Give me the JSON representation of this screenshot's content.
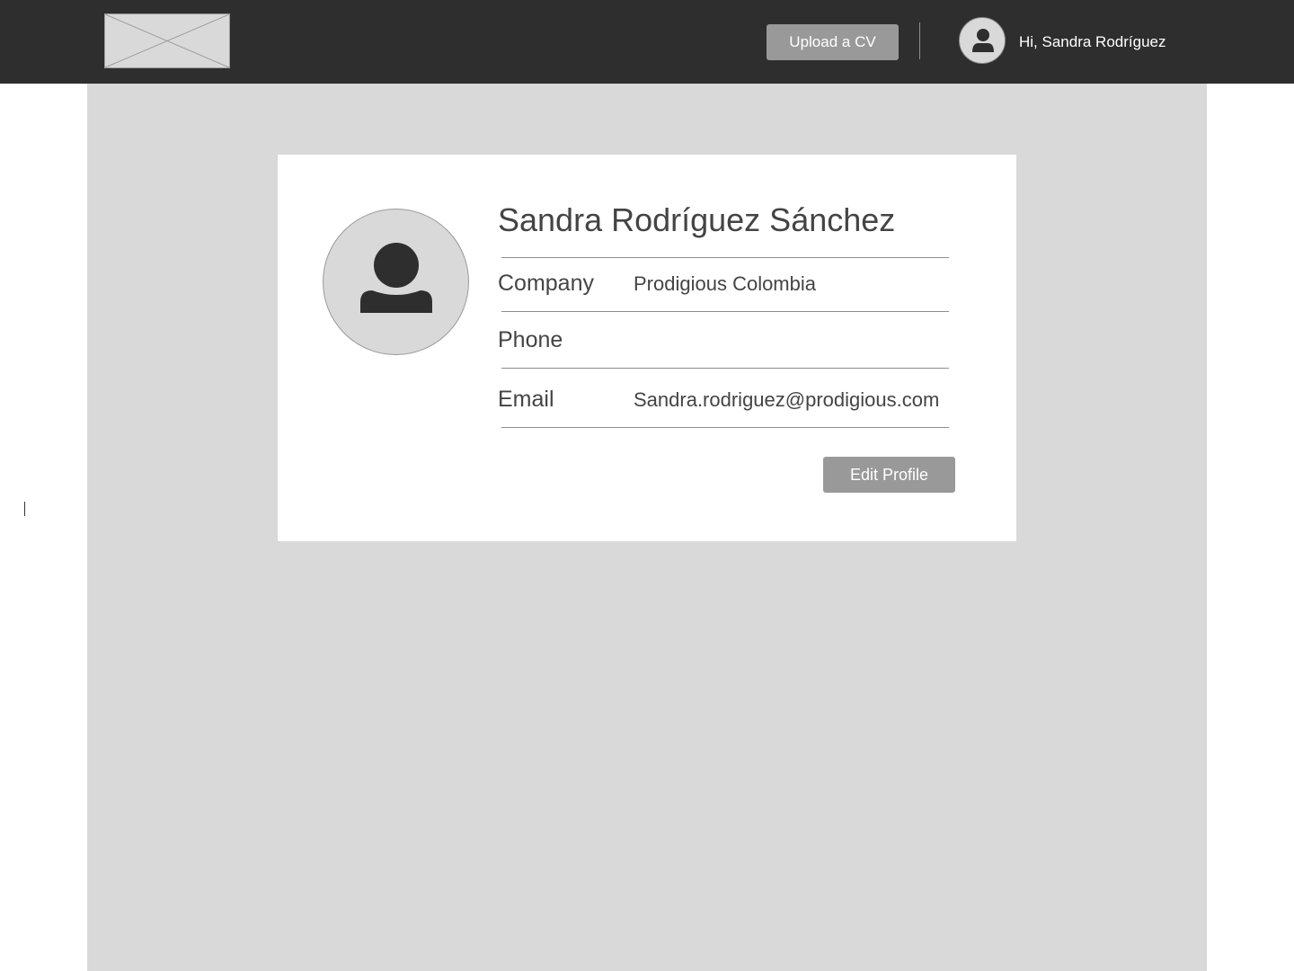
{
  "header": {
    "logo_icon": "image-placeholder-icon",
    "upload_label": "Upload a CV",
    "avatar_icon": "user-icon",
    "greeting": "Hi, Sandra Rodríguez"
  },
  "profile": {
    "avatar_icon": "user-icon",
    "full_name": "Sandra Rodríguez Sánchez",
    "fields": [
      {
        "label": "Company",
        "value": "Prodigious Colombia"
      },
      {
        "label": "Phone",
        "value": ""
      },
      {
        "label": "Email",
        "value": "Sandra.rodriguez@prodigious.com"
      }
    ],
    "edit_label": "Edit Profile"
  },
  "colors": {
    "header_bg": "#2e2e2e",
    "canvas_bg": "#d9d9d9",
    "card_bg": "#ffffff",
    "button_bg": "#999999",
    "text": "#444444"
  }
}
